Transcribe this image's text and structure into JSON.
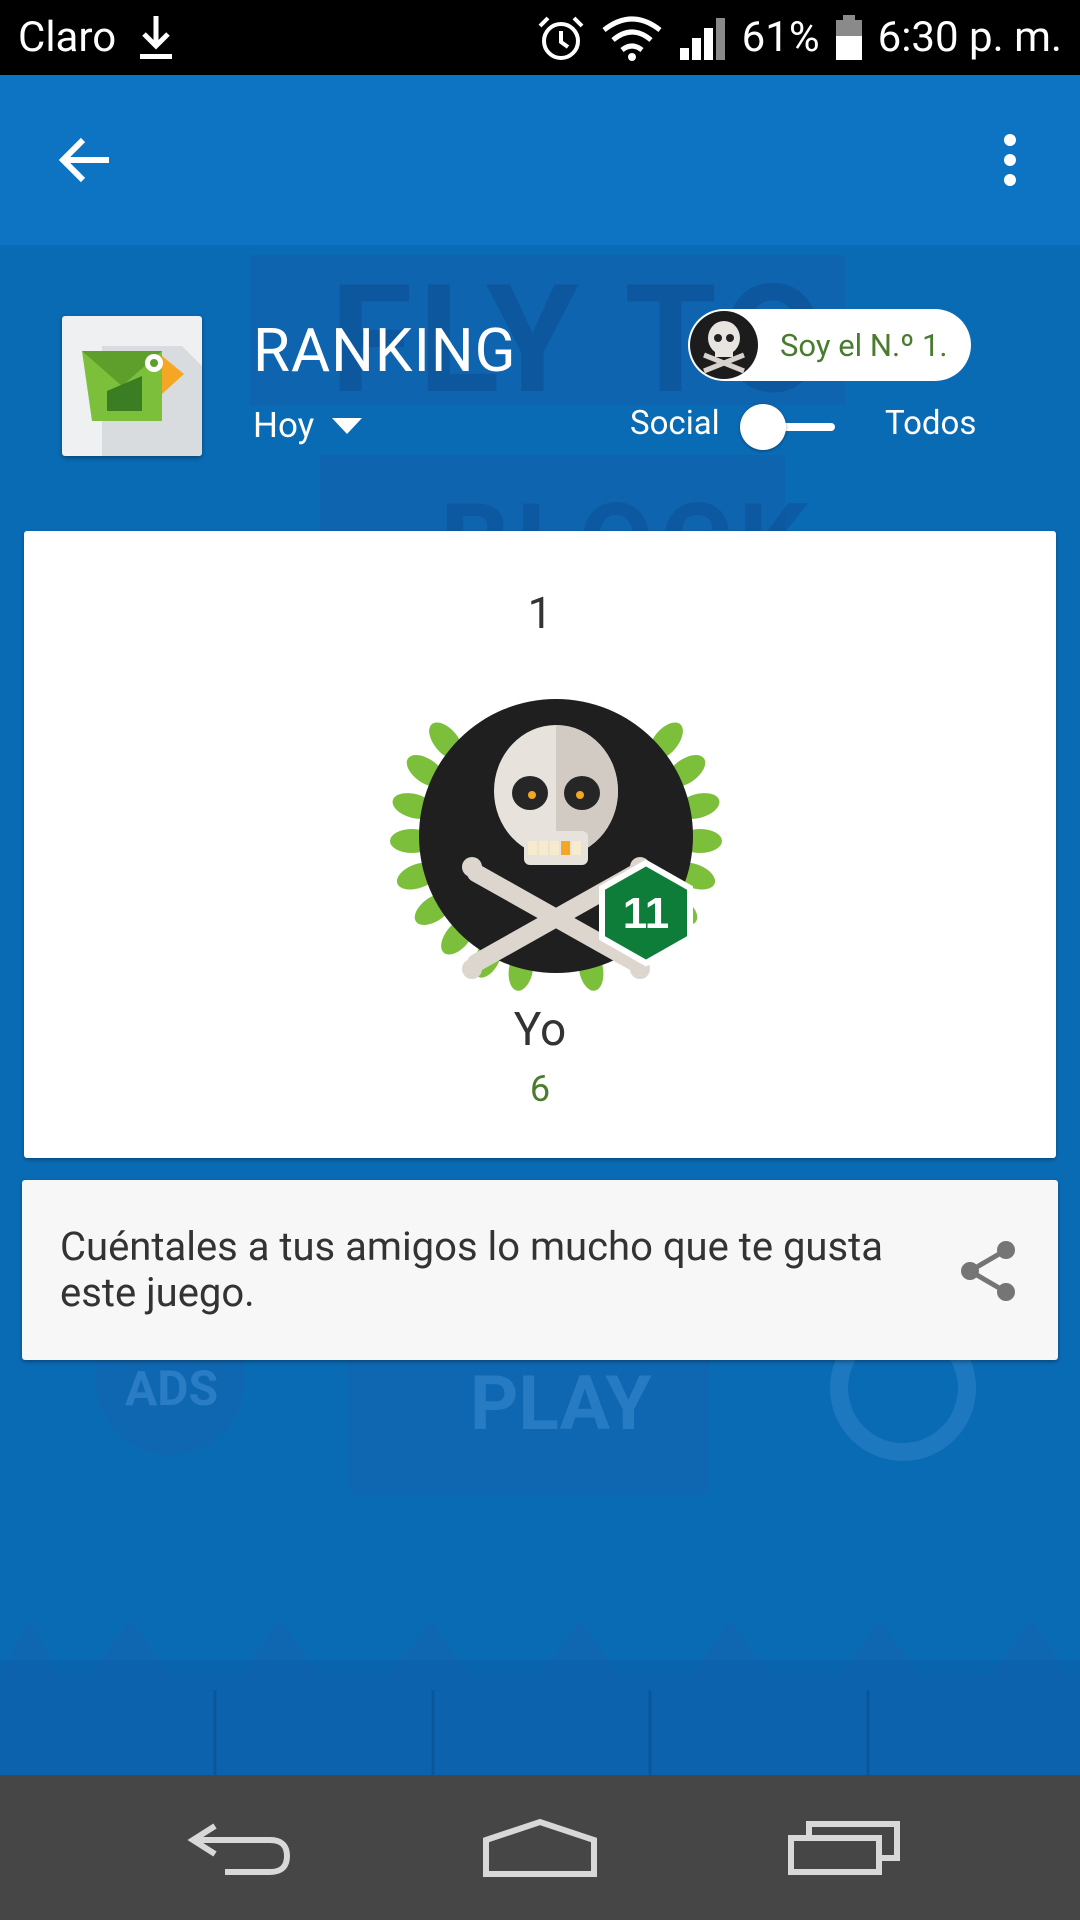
{
  "status_bar": {
    "carrier": "Claro",
    "battery": "61%",
    "time": "6:30 p. m.",
    "icons": [
      "download-icon",
      "alarm-icon",
      "wifi-icon",
      "signal-icon",
      "battery-icon"
    ]
  },
  "game_background": {
    "title_line1": "FLY TO",
    "title_line2": "BLOCK",
    "ads_label": "ADS",
    "play_label": "PLAY"
  },
  "header": {
    "title": "RANKING",
    "period": "Hoy",
    "top_chip_label": "Soy el N.º 1.",
    "toggle": {
      "left_label": "Social",
      "right_label": "Todos",
      "selected": "Social"
    }
  },
  "player": {
    "rank": "1",
    "name": "Yo",
    "score": "6",
    "level": "11"
  },
  "share": {
    "text": "Cuéntales a tus amigos lo mucho que te gusta este juego."
  },
  "colors": {
    "accent_green": "#4a7c2f",
    "level_badge": "#0f7d3a",
    "background_blue": "#0a6bb5"
  }
}
